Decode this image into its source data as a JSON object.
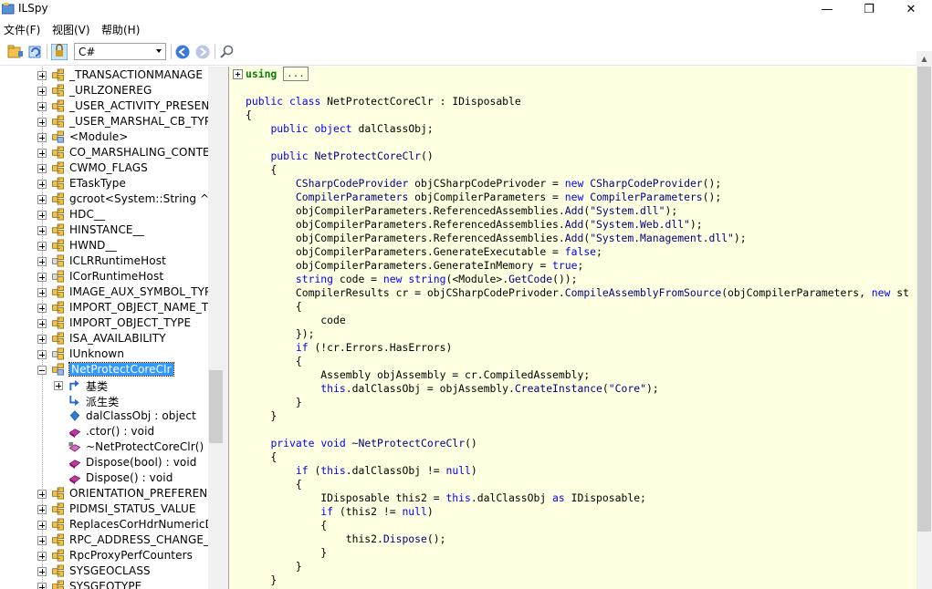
{
  "window": {
    "title": "ILSpy",
    "minimize": "—",
    "maximize": "❐",
    "close": "✕"
  },
  "menu": [
    "文件(F)",
    "视图(V)",
    "帮助(H)"
  ],
  "toolbar": {
    "language": "C#"
  },
  "tree": {
    "items": [
      {
        "label": "_TRANSACTIONMANAGE",
        "icon": "struct-icon",
        "expander": "+"
      },
      {
        "label": "_URLZONEREG",
        "icon": "struct-icon",
        "expander": "+"
      },
      {
        "label": "_USER_ACTIVITY_PRESENC",
        "icon": "struct-icon",
        "expander": "+"
      },
      {
        "label": "_USER_MARSHAL_CB_TYP",
        "icon": "struct-icon",
        "expander": "+"
      },
      {
        "label": "<Module>",
        "icon": "class-icon",
        "expander": "+"
      },
      {
        "label": "CO_MARSHALING_CONTE",
        "icon": "struct-icon",
        "expander": "+"
      },
      {
        "label": "CWMO_FLAGS",
        "icon": "struct-icon",
        "expander": "+"
      },
      {
        "label": "ETaskType",
        "icon": "struct-icon",
        "expander": "+"
      },
      {
        "label": "gcroot<System::String ^>",
        "icon": "struct-icon",
        "expander": "+"
      },
      {
        "label": "HDC__",
        "icon": "struct-icon",
        "expander": "+"
      },
      {
        "label": "HINSTANCE__",
        "icon": "struct-icon",
        "expander": "+"
      },
      {
        "label": "HWND__",
        "icon": "struct-icon",
        "expander": "+"
      },
      {
        "label": "ICLRRuntimeHost",
        "icon": "interface-icon",
        "expander": "+"
      },
      {
        "label": "ICorRuntimeHost",
        "icon": "interface-icon",
        "expander": "+"
      },
      {
        "label": "IMAGE_AUX_SYMBOL_TYP",
        "icon": "struct-icon",
        "expander": "+"
      },
      {
        "label": "IMPORT_OBJECT_NAME_T",
        "icon": "struct-icon",
        "expander": "+"
      },
      {
        "label": "IMPORT_OBJECT_TYPE",
        "icon": "struct-icon",
        "expander": "+"
      },
      {
        "label": "ISA_AVAILABILITY",
        "icon": "struct-icon",
        "expander": "+"
      },
      {
        "label": "IUnknown",
        "icon": "interface-icon",
        "expander": "+"
      },
      {
        "label": "NetProtectCoreClr",
        "icon": "class-icon",
        "expander": "-",
        "selected": true
      },
      {
        "label": "基类",
        "icon": "base-types-icon",
        "expander": "+",
        "child": true
      },
      {
        "label": "派生类",
        "icon": "derived-types-icon",
        "expander": "",
        "child": true
      },
      {
        "label": "dalClassObj : object",
        "icon": "field-icon",
        "expander": "",
        "child": true
      },
      {
        "label": ".ctor() : void",
        "icon": "method-icon",
        "expander": "",
        "child": true
      },
      {
        "label": "~NetProtectCoreClr() :",
        "icon": "destructor-icon",
        "expander": "",
        "child": true
      },
      {
        "label": "Dispose(bool) : void",
        "icon": "method-icon",
        "expander": "",
        "child": true
      },
      {
        "label": "Dispose() : void",
        "icon": "method-icon",
        "expander": "",
        "child": true
      },
      {
        "label": "ORIENTATION_PREFEREN",
        "icon": "struct-icon",
        "expander": "+"
      },
      {
        "label": "PIDMSI_STATUS_VALUE",
        "icon": "struct-icon",
        "expander": "+"
      },
      {
        "label": "ReplacesCorHdrNumericD",
        "icon": "struct-icon",
        "expander": "+"
      },
      {
        "label": "RPC_ADDRESS_CHANGE_T",
        "icon": "struct-icon",
        "expander": "+"
      },
      {
        "label": "RpcProxyPerfCounters",
        "icon": "struct-icon",
        "expander": "+"
      },
      {
        "label": "SYSGEOCLASS",
        "icon": "struct-icon",
        "expander": "+"
      },
      {
        "label": "SYSGEOTYPE",
        "icon": "struct-icon",
        "expander": "+"
      }
    ]
  },
  "editor": {
    "using_keyword": "using",
    "using_ellipsis": "...",
    "lines": [
      "",
      "public class NetProtectCoreClr : IDisposable",
      "{",
      "    public object dalClassObj;",
      "",
      "    public NetProtectCoreClr()",
      "    {",
      "        CSharpCodeProvider objCSharpCodePrivoder = new CSharpCodeProvider();",
      "        CompilerParameters objCompilerParameters = new CompilerParameters();",
      "        objCompilerParameters.ReferencedAssemblies.Add(\"System.dll\");",
      "        objCompilerParameters.ReferencedAssemblies.Add(\"System.Web.dll\");",
      "        objCompilerParameters.ReferencedAssemblies.Add(\"System.Management.dll\");",
      "        objCompilerParameters.GenerateExecutable = false;",
      "        objCompilerParameters.GenerateInMemory = true;",
      "        string code = new string(<Module>.GetCode());",
      "        CompilerResults cr = objCSharpCodePrivoder.CompileAssemblyFromSource(objCompilerParameters, new st",
      "        {",
      "            code",
      "        });",
      "        if (!cr.Errors.HasErrors)",
      "        {",
      "            Assembly objAssembly = cr.CompiledAssembly;",
      "            this.dalClassObj = objAssembly.CreateInstance(\"Core\");",
      "        }",
      "    }",
      "",
      "    private void ~NetProtectCoreClr()",
      "    {",
      "        if (this.dalClassObj != null)",
      "        {",
      "            IDisposable this2 = this.dalClassObj as IDisposable;",
      "            if (this2 != null)",
      "            {",
      "                this2.Dispose();",
      "            }",
      "        }",
      "    }"
    ]
  }
}
